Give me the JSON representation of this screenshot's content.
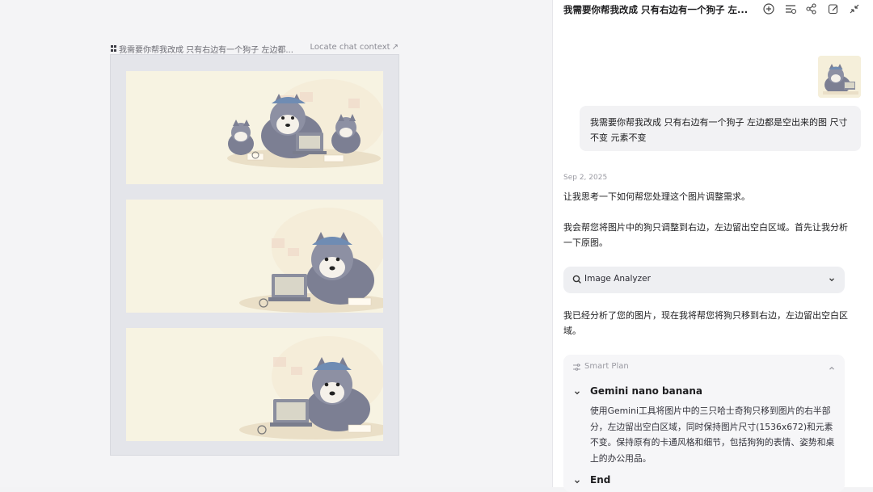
{
  "canvas": {
    "header_title": "我需要你帮我改成 只有右边有一个狗子 左边都...",
    "locate_label": "Locate chat context",
    "cards": [
      {
        "label": "Original image: three husky dogs around a laptop"
      },
      {
        "label": "Edited image: one husky on the right, blank left"
      },
      {
        "label": "Edited image variant: one husky on the right, blank left"
      }
    ]
  },
  "chat": {
    "title": "我需要你帮我改成 只有右边有一个狗子 左...",
    "toolbar_icons": [
      "new-chat-icon",
      "history-list-icon",
      "share-icon",
      "edit-icon",
      "collapse-icon"
    ],
    "user_message": "我需要你帮我改成 只有右边有一个狗子 左边都是空出来的图 尺寸不变 元素不变",
    "date": "Sep 2, 2025",
    "assistant_para_1": "让我思考一下如何帮您处理这个图片调整需求。",
    "assistant_para_2": "我会帮您将图片中的狗只调整到右边，左边留出空白区域。首先让我分析一下原图。",
    "tool_label": "Image Analyzer",
    "assistant_para_3": "我已经分析了您的图片，现在我将帮您将狗只移到右边，左边留出空白区域。",
    "plan": {
      "header": "Smart Plan",
      "steps": [
        {
          "title": "Gemini nano banana",
          "description": "使用Gemini工具将图片中的三只哈士奇狗只移到图片的右半部分，左边留出空白区域，同时保持图片尺寸(1536x672)和元素不变。保持原有的卡通风格和细节，包括狗狗的表情、姿势和桌上的办公用品。"
        },
        {
          "title": "End"
        }
      ]
    }
  },
  "colors": {
    "canvas_bg": "#f4f4f6",
    "card_bg": "#f7f3e2",
    "husky_grey": "#7c7f93",
    "bubble_bg": "#f2f2f4"
  }
}
